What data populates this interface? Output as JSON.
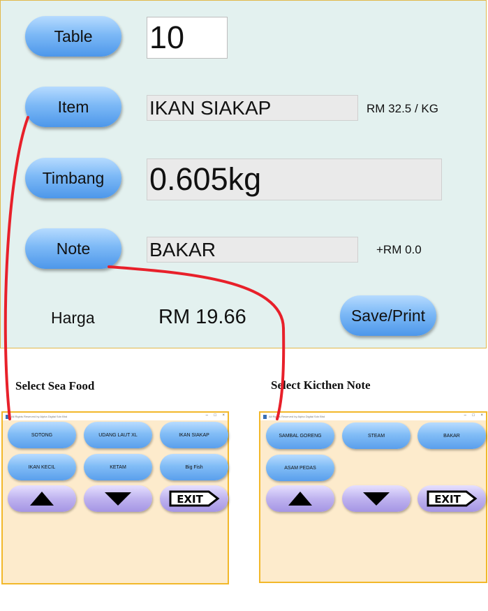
{
  "main": {
    "table_label": "Table",
    "table_value": "10",
    "item_label": "Item",
    "item_value": "IKAN SIAKAP",
    "item_price": "RM 32.5 / KG",
    "timbang_label": "Timbang",
    "timbang_value": "0.605kg",
    "note_label": "Note",
    "note_value": "BAKAR",
    "note_price": "+RM 0.0",
    "harga_label": "Harga",
    "harga_value": "RM 19.66",
    "save_label": "Save/Print"
  },
  "captions": {
    "seafood": "Select Sea Food",
    "kitchen": "Select Kicthen Note"
  },
  "seafood_window": {
    "title": "All Rights Reserved by Alpha Digital Sdn Bhd",
    "items": [
      "SOTONG",
      "UDANG LAUT XL",
      "IKAN SIAKAP",
      "IKAN KECIL",
      "KETAM",
      "Big Fish"
    ],
    "exit_label": "EXIT"
  },
  "kitchen_window": {
    "title": "All Rights Reserved by Alpha Digital Sdn Bhd",
    "items": [
      "SAMBAL GORENG",
      "STEAM",
      "BAKAR",
      "ASAM PEDAS"
    ],
    "exit_label": "EXIT"
  },
  "icons": {
    "up": "triangle-up",
    "down": "triangle-down",
    "exit": "exit-sign"
  },
  "colors": {
    "panel_bg": "#e3f1ef",
    "button_blue": "#7db9f6",
    "popup_bg": "#fdebcc",
    "popup_border": "#f2b82a",
    "connector": "#e8202a",
    "nav_purple": "#bfb3ef"
  }
}
